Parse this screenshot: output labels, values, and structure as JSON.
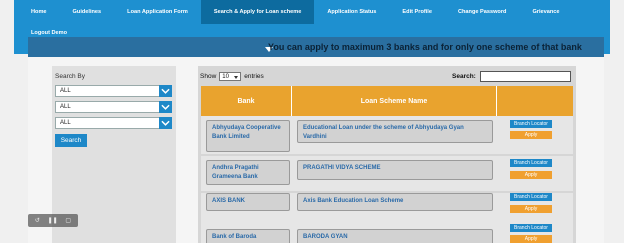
{
  "nav": {
    "items": [
      {
        "label": "Home"
      },
      {
        "label": "Guidelines"
      },
      {
        "label": "Loan Application Form"
      },
      {
        "label": "Search & Apply for Loan scheme"
      },
      {
        "label": "Application Status"
      },
      {
        "label": "Edit Profile"
      },
      {
        "label": "Change Password"
      },
      {
        "label": "Grievance"
      }
    ],
    "logout": "Logout Demo",
    "active_index": 3
  },
  "banner": {
    "text": "You can apply to maximum 3 banks and for only one scheme of that bank"
  },
  "sidebar": {
    "label": "Search By",
    "filters": [
      {
        "value": "ALL"
      },
      {
        "value": "ALL"
      },
      {
        "value": "ALL"
      }
    ],
    "search_button": "Search"
  },
  "table": {
    "show_prefix": "Show",
    "show_value": "10",
    "show_suffix": "entries",
    "search_label": "Search:",
    "columns": [
      "Bank",
      "Loan Scheme Name",
      ""
    ],
    "rows": [
      {
        "bank": "Abhyudaya Cooperative Bank Limited",
        "scheme": "Educational Loan under the scheme of Abhyudaya Gyan Vardhini",
        "locator": "Branch Locator",
        "apply": "Apply"
      },
      {
        "bank": "Andhra Pragathi Grameena Bank",
        "scheme": "PRAGATHI VIDYA SCHEME",
        "locator": "Branch Locator",
        "apply": "Apply"
      },
      {
        "bank": "AXIS BANK",
        "scheme": "Axis Bank Education Loan Scheme",
        "locator": "Branch Locator",
        "apply": "Apply"
      },
      {
        "bank": "Bank of Baroda",
        "scheme": "BARODA GYAN",
        "locator": "Branch Locator",
        "apply": "Apply"
      }
    ]
  },
  "colors": {
    "nav_bg": "#1e90d0",
    "nav_active": "#0d6b9f",
    "header_orange": "#e9a32e",
    "link_blue": "#2a6aa8",
    "apply_orange": "#f0a030"
  }
}
